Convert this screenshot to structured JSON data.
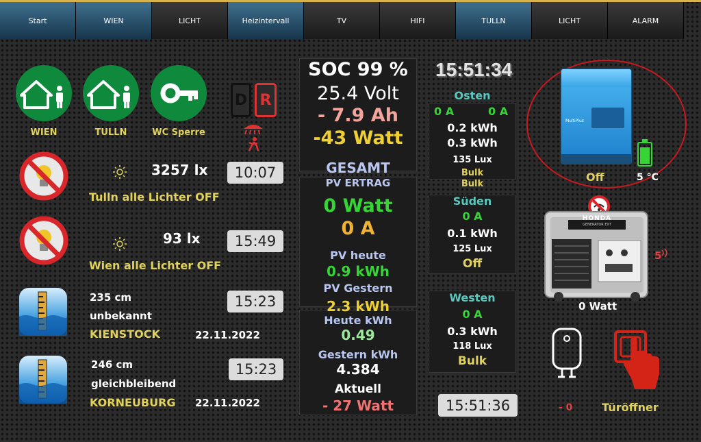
{
  "nav": {
    "tabs": [
      {
        "label": "Start",
        "active": true
      },
      {
        "label": "WIEN",
        "active": true
      },
      {
        "label": "LICHT",
        "active": false
      },
      {
        "label": "Heizintervall",
        "active": true
      },
      {
        "label": "TV",
        "active": false
      },
      {
        "label": "HIFI",
        "active": false
      },
      {
        "label": "TULLN",
        "active": true
      },
      {
        "label": "LICHT",
        "active": false
      },
      {
        "label": "ALARM",
        "active": false
      }
    ]
  },
  "home": {
    "wien_label": "WIEN",
    "tulln_label": "TULLN",
    "wc_label": "WC Sperre"
  },
  "phones": {
    "left_letter": "D",
    "right_letter": "R"
  },
  "light": {
    "tulln_lux": "3257 lx",
    "tulln_time": "10:07",
    "tulln_status": "Tulln alle Lichter OFF",
    "wien_lux": "93 lx",
    "wien_time": "15:49",
    "wien_status": "Wien alle Lichter OFF"
  },
  "gauges": [
    {
      "level": "235 cm",
      "trend": "unbekannt",
      "station": "KIENSTOCK",
      "date": "22.11.2022",
      "time": "15:23"
    },
    {
      "level": "246 cm",
      "trend": "gleichbleibend",
      "station": "KORNEUBURG",
      "date": "22.11.2022",
      "time": "15:23"
    }
  ],
  "battery": {
    "soc": "SOC 99 %",
    "volt": "25.4 Volt",
    "ah": "- 7.9 Ah",
    "watt": "-43 Watt"
  },
  "pv": {
    "gesamt": "GESAMT",
    "ertrag_label": "PV ERTRAG",
    "watt": "0 Watt",
    "amp": "0 A",
    "heute_label": "PV heute",
    "heute": "0.9 kWh",
    "gestern_label": "PV Gestern",
    "gestern": "2.3 kWh",
    "heute_kwh_label": "Heute kWh",
    "heute_kwh": "0.49",
    "gestern_kwh_label": "Gestern kWh",
    "gestern_kwh": "4.384",
    "aktuell_label": "Aktuell",
    "aktuell": "- 27 Watt"
  },
  "clock": {
    "top": "15:51:34",
    "bottom": "15:51:36"
  },
  "strings": [
    {
      "name": "Osten",
      "amp1": "0 A",
      "amp2": "0 A",
      "kwh1": "0.2 kWh",
      "kwh2": "0.3 kWh",
      "lux": "135 Lux",
      "state1": "Bulk",
      "state2": "Bulk"
    },
    {
      "name": "Süden",
      "amp": "0 A",
      "kwh": "0.1 kWh",
      "lux": "125 Lux",
      "state": "Off"
    },
    {
      "name": "Westen",
      "amp": "0 A",
      "kwh": "0.3 kWh",
      "lux": "118 Lux",
      "state": "Bulk"
    }
  ],
  "inverter": {
    "state": "Off",
    "temp": "5 °C",
    "brand": "MultiPlus",
    "battery_fill": 0.85
  },
  "generator": {
    "brand": "HONDA",
    "model": "GENERATOR EXT",
    "watt": "0 Watt",
    "counter": "5"
  },
  "boiler": {
    "value": "- 0"
  },
  "door": {
    "label": "Türöffner"
  },
  "colors": {
    "green": "#0f8a3c",
    "yellow": "#e0d25a",
    "pvgreen": "#37d437",
    "orange": "#f0b232",
    "salmon": "#f4a49a",
    "red": "#e04040",
    "cyan": "#59c9c0"
  }
}
